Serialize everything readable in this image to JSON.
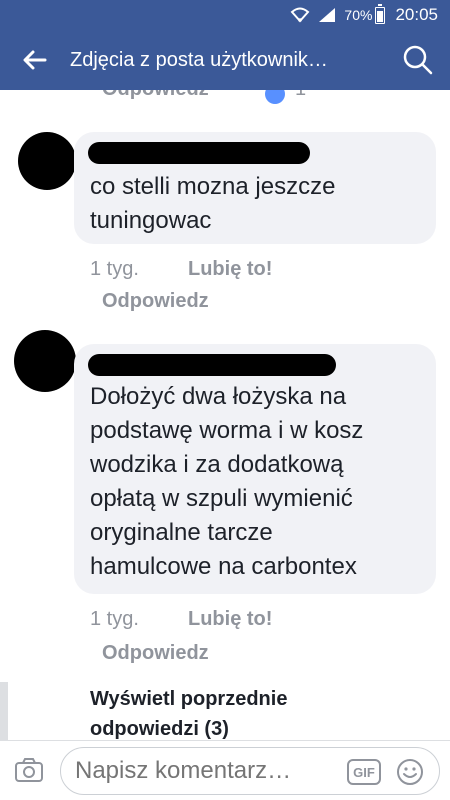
{
  "status_bar": {
    "battery": "70%",
    "time": "20:05"
  },
  "app_bar": {
    "title": "Zdjęcia z posta użytkownik…"
  },
  "top_partial": {
    "reply_label": "Odpowiedz",
    "like_count": "1"
  },
  "comments": [
    {
      "text_lines": [
        "co stelli mozna jeszcze",
        "tuningowac"
      ],
      "time": "1 tyg.",
      "like_label": "Lubię to!",
      "reply_label": "Odpowiedz"
    },
    {
      "text_lines": [
        "Dołożyć dwa łożyska na",
        "podstawę worma i w kosz",
        "wodzika i za dodatkową",
        "opłatą w szpuli wymienić",
        "oryginalne tarcze",
        "hamulcowe na carbontex"
      ],
      "time": "1 tyg.",
      "like_label": "Lubię to!",
      "reply_label": "Odpowiedz"
    }
  ],
  "previous_replies": {
    "line1": "Wyświetl poprzednie",
    "line2": "odpowiedzi (3)"
  },
  "composer": {
    "placeholder": "Napisz komentarz…",
    "gif_label": "GIF"
  },
  "colors": {
    "brand": "#3b5998",
    "bubble": "#f1f2f6",
    "meta_text": "#90949c"
  }
}
